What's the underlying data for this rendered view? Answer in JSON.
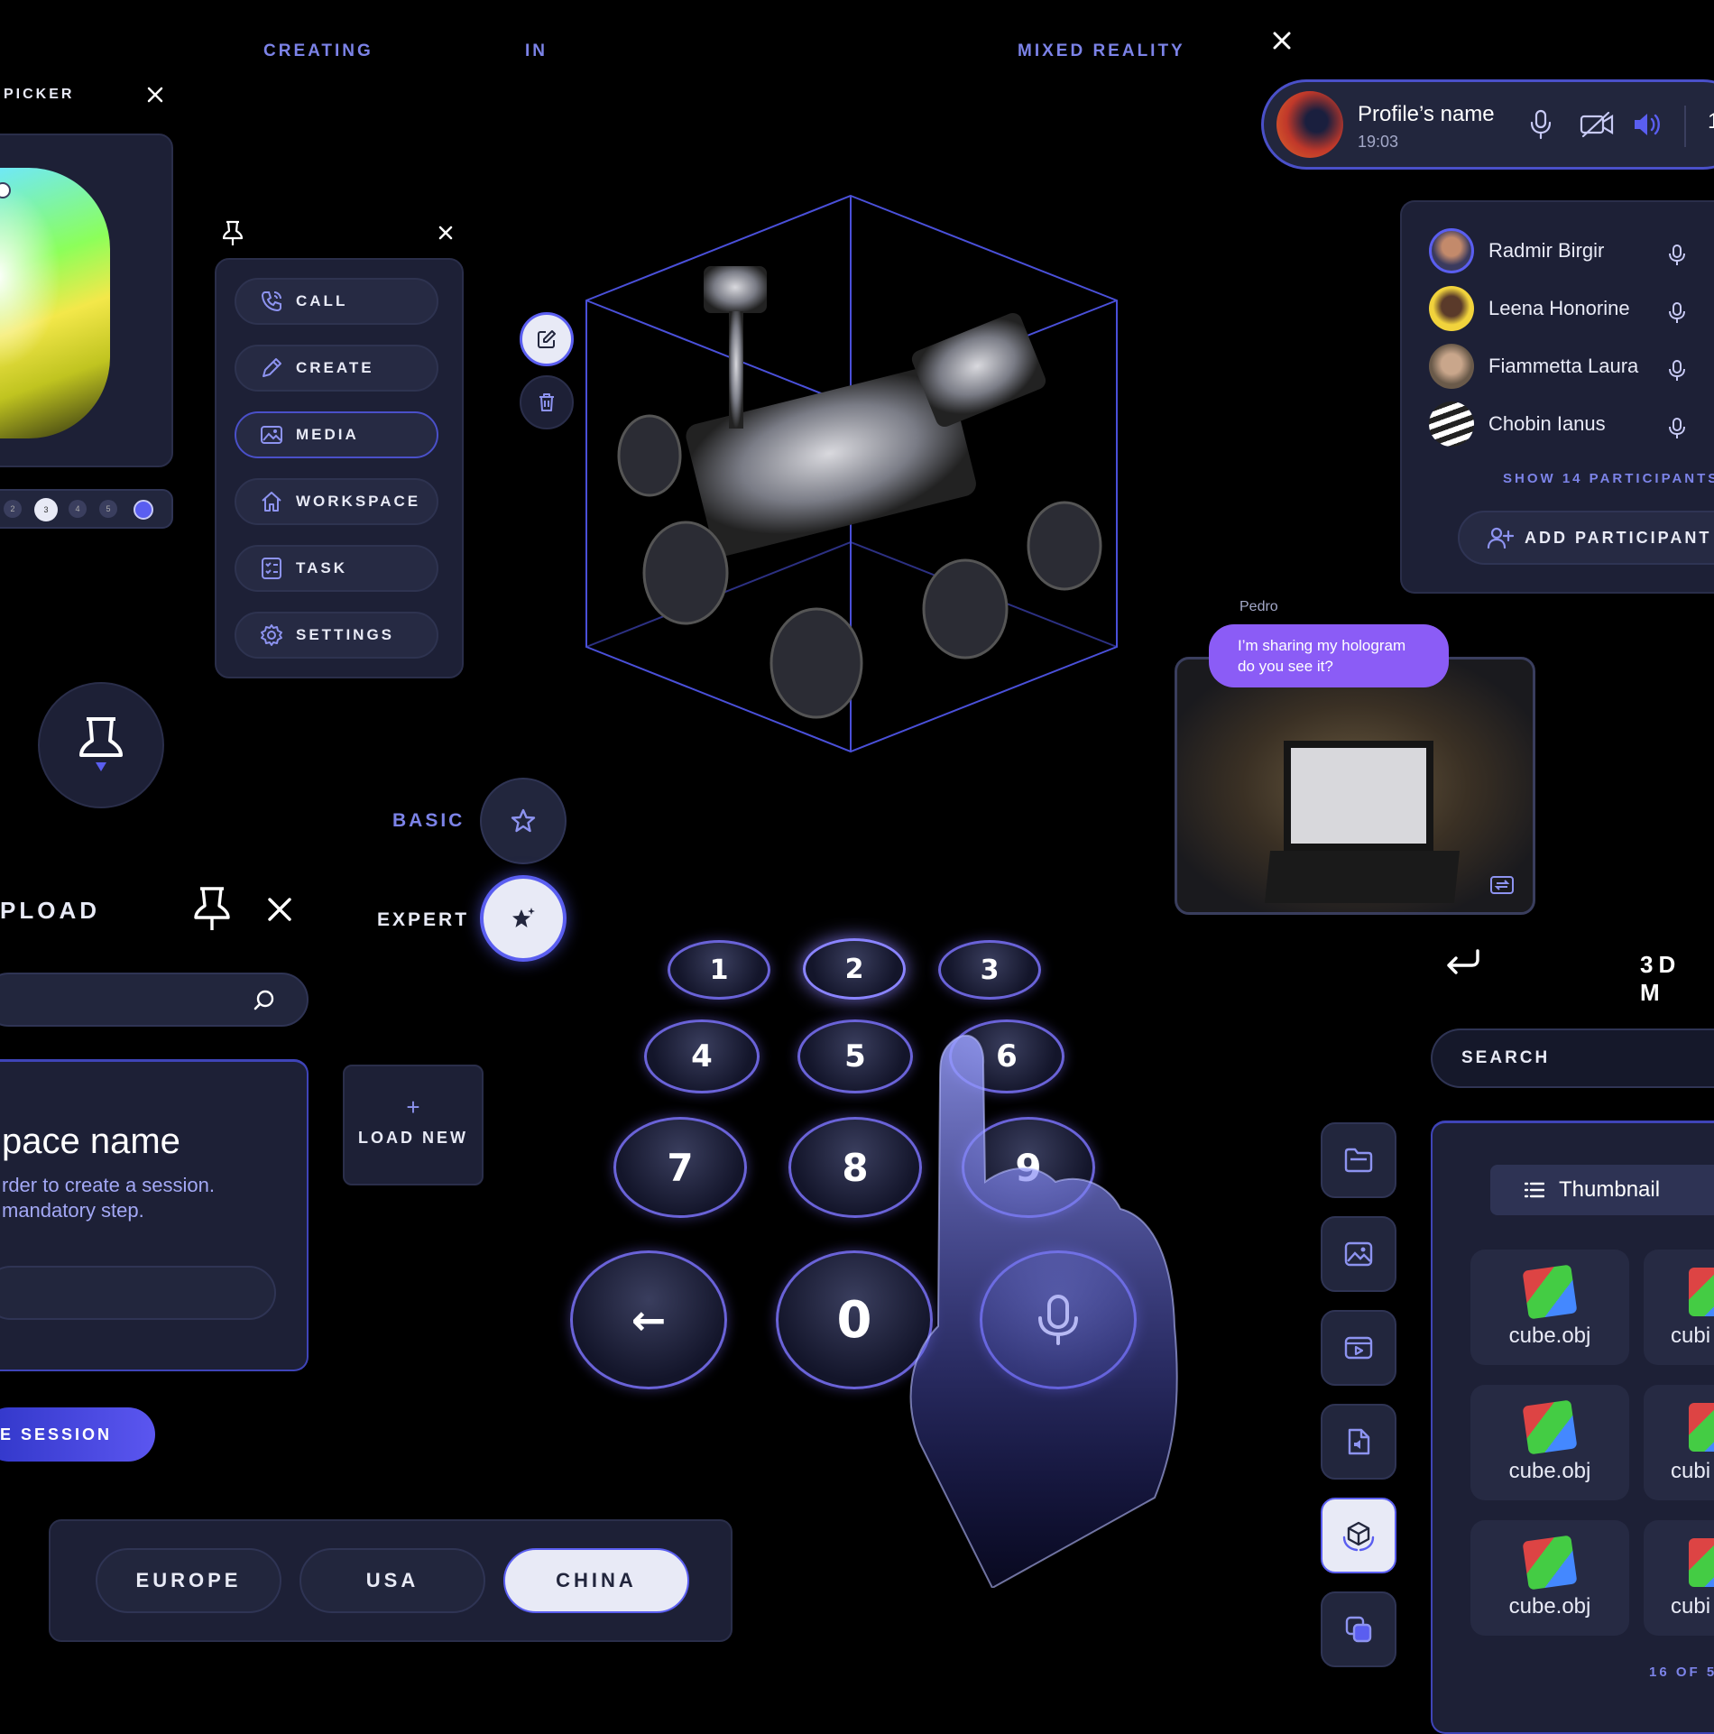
{
  "header": {
    "word1": "CREATING",
    "word2": "IN",
    "word3": "MIXED REALITY"
  },
  "colors": {
    "background": "#000000",
    "panel": "#1d2036",
    "accent": "#7c83e8",
    "accent_strong": "#5a5ef0",
    "chat_bubble": "#8b5cf6"
  },
  "color_picker": {
    "title": "PICKER",
    "swatch_labels": [
      "2",
      "3",
      "4",
      "5"
    ]
  },
  "menu": {
    "items": [
      {
        "label": "CALL",
        "icon": "phone-icon"
      },
      {
        "label": "CREATE",
        "icon": "pencil-icon"
      },
      {
        "label": "MEDIA",
        "icon": "image-icon"
      },
      {
        "label": "WORKSPACE",
        "icon": "home-icon"
      },
      {
        "label": "TASK",
        "icon": "checklist-icon"
      },
      {
        "label": "SETTINGS",
        "icon": "gear-icon"
      }
    ],
    "active_index": 2
  },
  "modes": {
    "basic": "BASIC",
    "expert": "EXPERT",
    "selected": "EXPERT"
  },
  "upload": {
    "title": "PLOAD",
    "card_title": "pace name",
    "card_desc_line1": "rder to create a session.",
    "card_desc_line2": "mandatory step.",
    "load_new_plus": "+",
    "load_new": "LOAD NEW",
    "session_button": "E SESSION"
  },
  "regions": {
    "items": [
      "EUROPE",
      "USA",
      "CHINA"
    ],
    "selected": "CHINA"
  },
  "keypad": {
    "keys": [
      "1",
      "2",
      "3",
      "4",
      "5",
      "6",
      "7",
      "8",
      "9",
      "←",
      "0"
    ]
  },
  "call": {
    "profile_name": "Profile’s name",
    "time": "19:03",
    "cut_counter": "1",
    "participants": [
      {
        "name": "Radmir Birgir"
      },
      {
        "name": "Leena Honorine"
      },
      {
        "name": "Fiammetta Laura"
      },
      {
        "name": "Chobin Ianus"
      }
    ],
    "show_more": "SHOW 14 PARTICIPANTS",
    "add_participant": "ADD PARTICIPANT"
  },
  "chat": {
    "sender": "Pedro",
    "message_line1": "I’m sharing my hologram",
    "message_line2": "do you see it?"
  },
  "models": {
    "title": "3D M",
    "search_placeholder": "SEARCH",
    "view_toggle": "Thumbnail",
    "files": [
      "cube.obj",
      "cube.obj",
      "cube.obj"
    ],
    "cut_files": [
      "cubi",
      "cubi",
      "cubi"
    ],
    "pagination": "16 OF 5"
  },
  "sidebar_icons": [
    "folder-icon",
    "image-icon",
    "video-icon",
    "audio-file-icon",
    "cube-icon",
    "layers-icon"
  ],
  "sidebar_active_index": 4
}
